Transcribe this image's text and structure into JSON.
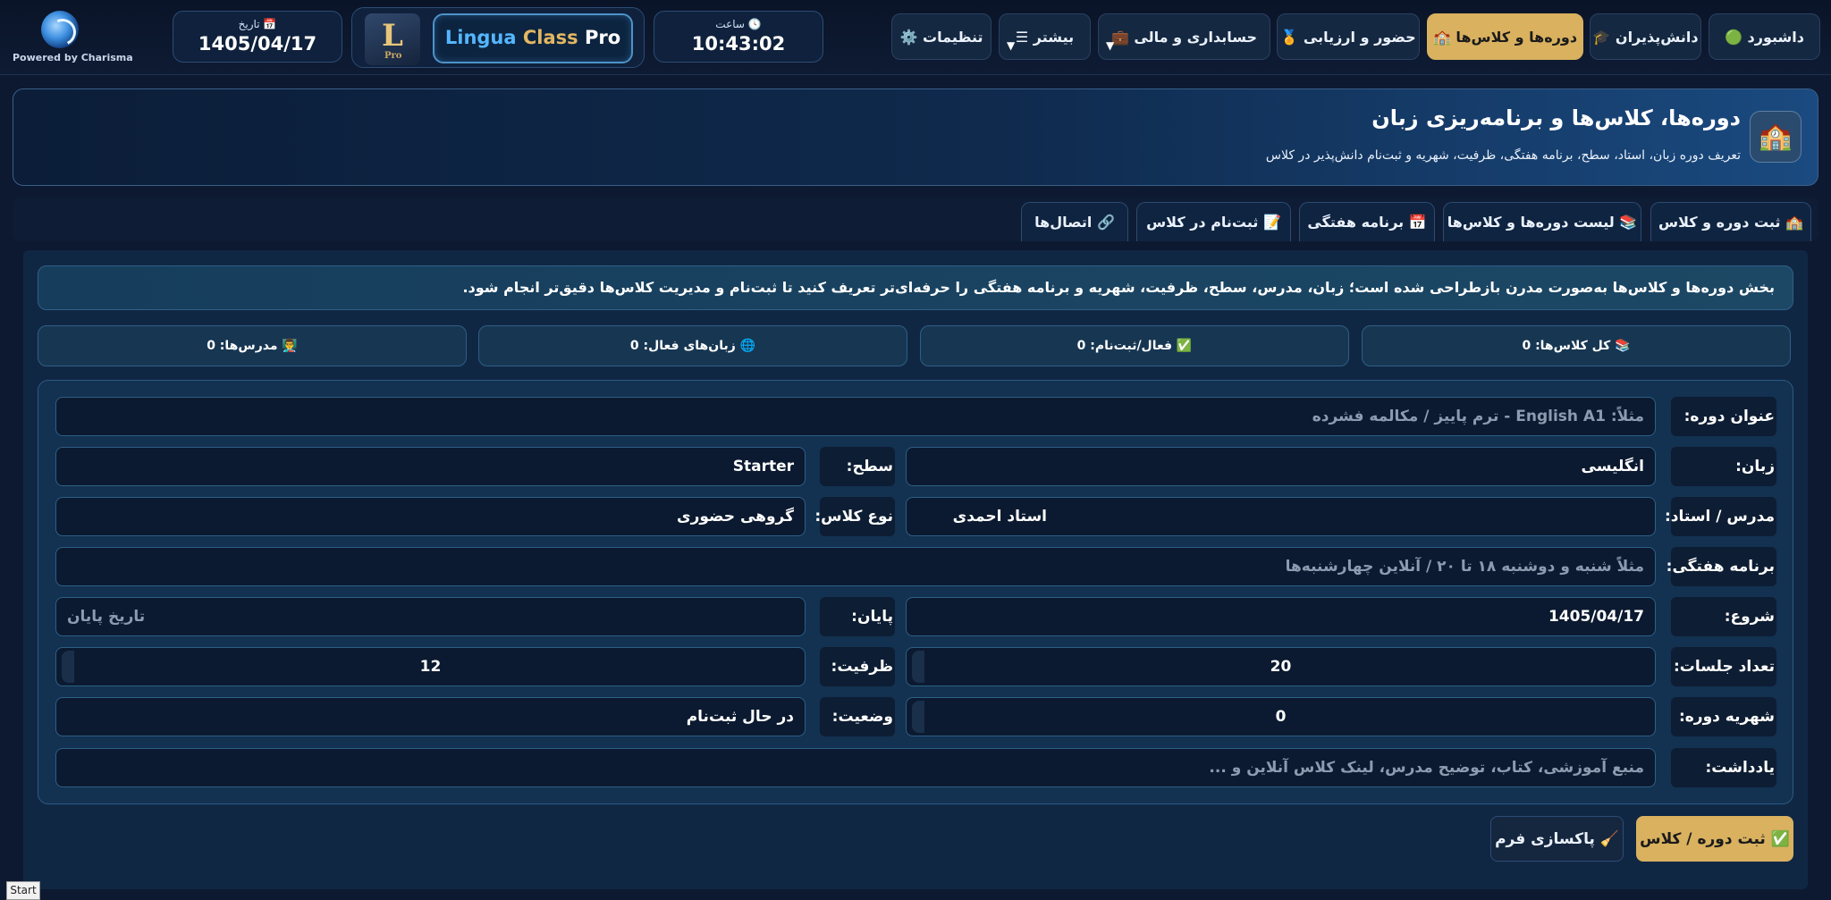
{
  "brand": {
    "powered": "Powered by Charisma"
  },
  "date": {
    "label": "تاریخ 📅",
    "value": "1405/04/17"
  },
  "app": {
    "title_a": "Lingua",
    "title_b": "Class",
    "title_c": "Pro",
    "logo_letter": "L",
    "logo_small": "Pro"
  },
  "time": {
    "label": "ساعت 🕓",
    "value": "10:43:02"
  },
  "nav": {
    "dashboard": "داشبورد 🟢",
    "students": "دانش‌پذیران 🎓",
    "courses": "دوره‌ها و کلاس‌ها 🏫",
    "attendance": "حضور و ارزیابی 🏅",
    "accounting": "حسابداری و مالی 💼",
    "more": "بیشتر ☰",
    "settings": "تنظیمات ⚙️"
  },
  "hero": {
    "icon": "🏫",
    "title": "دوره‌ها، کلاس‌ها و برنامه‌ریزی زبان",
    "subtitle": "تعریف دوره زبان، استاد، سطح، برنامه هفتگی، ظرفیت، شهریه و ثبت‌نام دانش‌پذیر در کلاس"
  },
  "tabs": {
    "register": "🏫 ثبت دوره و کلاس",
    "list": "📚 لیست دوره‌ها و کلاس‌ها",
    "weekly": "📅 برنامه هفتگی",
    "enroll": "📝 ثبت‌نام در کلاس",
    "connections": "🔗 اتصال‌ها"
  },
  "notice": "بخش دوره‌ها و کلاس‌ها به‌صورت مدرن بازطراحی شده است؛ زبان، مدرس، سطح، ظرفیت، شهریه و برنامه هفتگی را حرفه‌ای‌تر تعریف کنید تا ثبت‌نام و مدیریت کلاس‌ها دقیق‌تر انجام شود.",
  "stats": {
    "total": "📚 کل کلاس‌ها: 0",
    "active": "✅ فعال/ثبت‌نام: 0",
    "languages": "🌐 زبان‌های فعال: 0",
    "teachers": "👨‍🏫 مدرس‌ها: 0"
  },
  "form": {
    "title_label": "عنوان دوره:",
    "title_placeholder": "مثلاً: English A1 - ترم پاییز / مکالمه فشرده",
    "language_label": "زبان:",
    "language_value": "انگلیسی",
    "level_label": "سطح:",
    "level_value": "Starter",
    "teacher_label": "مدرس / استاد:",
    "teacher_value": "استاد احمدی",
    "type_label": "نوع کلاس:",
    "type_value": "گروهی حضوری",
    "schedule_label": "برنامه هفتگی:",
    "schedule_placeholder": "مثلاً شنبه و دوشنبه ۱۸ تا ۲۰ / آنلاین چهارشنبه‌ها",
    "start_label": "شروع:",
    "start_value": "1405/04/17",
    "end_label": "پایان:",
    "end_placeholder": "تاریخ پایان",
    "sessions_label": "تعداد جلسات:",
    "sessions_value": "20",
    "capacity_label": "ظرفیت:",
    "capacity_value": "12",
    "fee_label": "شهریه دوره:",
    "fee_value": "0",
    "status_label": "وضعیت:",
    "status_value": "در حال ثبت‌نام",
    "note_label": "یادداشت:",
    "note_placeholder": "منبع آموزشی، کتاب، توضیح مدرس، لینک کلاس آنلاین و ..."
  },
  "buttons": {
    "save": "✅ ثبت دوره / کلاس",
    "clear": "🧹 پاکسازی فرم"
  },
  "taskbar": {
    "start": "Start"
  }
}
